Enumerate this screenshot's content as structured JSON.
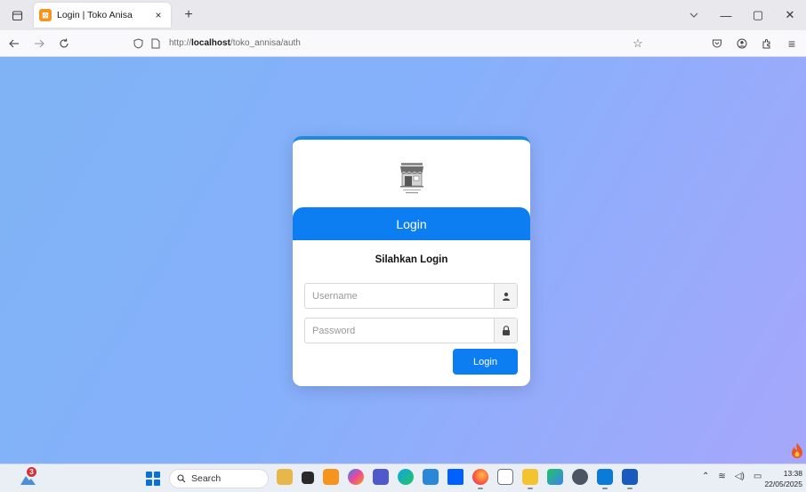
{
  "browser": {
    "tab_title": "Login | Toko Anisa",
    "tab_close": "×",
    "new_tab": "+",
    "url_prefix": "http://",
    "url_host": "localhost",
    "url_path": "/toko_annisa/auth",
    "minimize": "—",
    "restore": "▢",
    "close": "✕",
    "menu": "≡"
  },
  "login": {
    "header": "Login",
    "subtitle": "Silahkan Login",
    "username_placeholder": "Username",
    "password_placeholder": "Password",
    "button": "Login",
    "accent_color": "#0d7ef2"
  },
  "taskbar": {
    "search_label": "Search",
    "notification_count": "3",
    "time": "13:38",
    "date": "22/05/2025",
    "apps": [
      "file-explorer",
      "task-view",
      "xampp",
      "copilot",
      "teams",
      "edge",
      "photos",
      "dropbox",
      "firefox",
      "text-editor",
      "files",
      "store",
      "browser",
      "vscode",
      "word"
    ]
  }
}
